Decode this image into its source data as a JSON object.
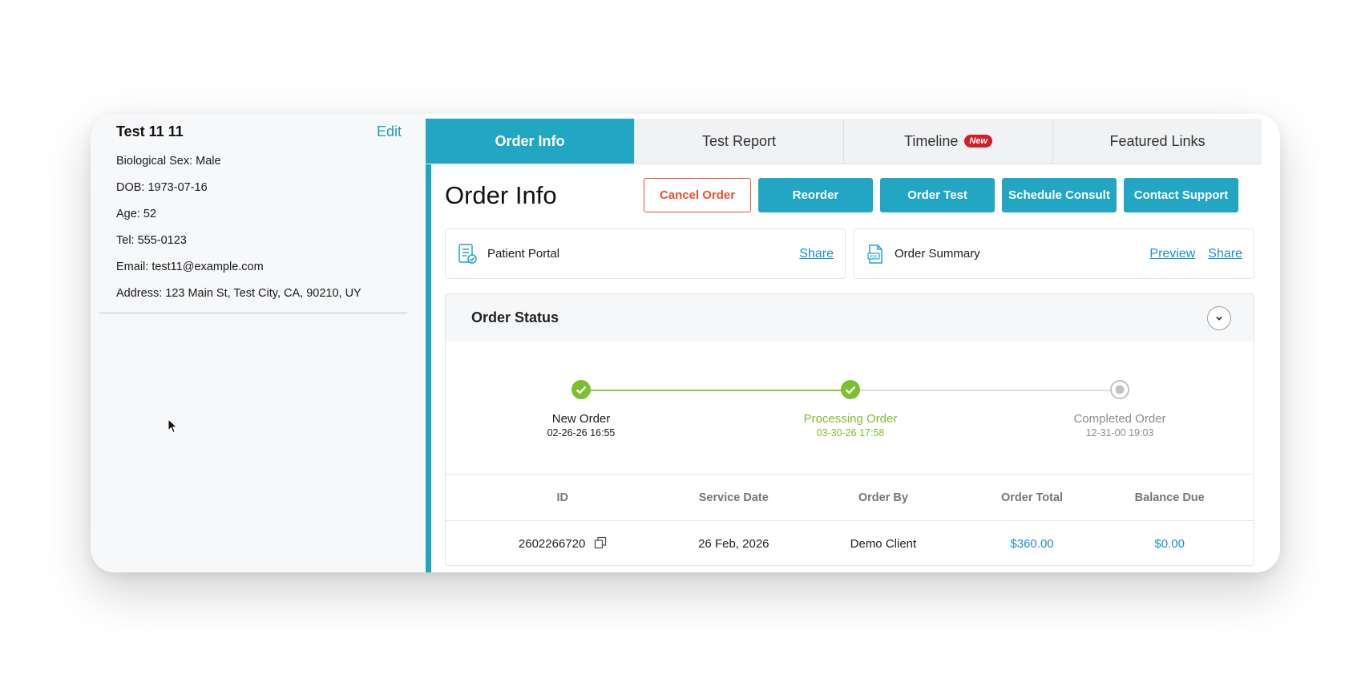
{
  "patient": {
    "name": "Test 11 11",
    "edit_label": "Edit",
    "info": [
      "Biological Sex: Male",
      "DOB: 1973-07-16",
      "Age: 52",
      "Tel: 555-0123",
      "Email: test11@example.com",
      "Address: 123 Main St, Test City, CA, 90210, UY"
    ]
  },
  "tabs": [
    {
      "label": "Order Info",
      "active": true
    },
    {
      "label": "Test Report",
      "active": false
    },
    {
      "label": "Timeline",
      "active": false,
      "badge": "New"
    },
    {
      "label": "Featured Links",
      "active": false
    }
  ],
  "page": {
    "title": "Order Info",
    "buttons": {
      "cancel": "Cancel Order",
      "reorder": "Reorder",
      "order_test": "Order Test",
      "schedule": "Schedule Consult",
      "support": "Contact Support"
    }
  },
  "links": {
    "portal": {
      "label": "Patient Portal",
      "share": "Share"
    },
    "summary": {
      "label": "Order Summary",
      "preview": "Preview",
      "share": "Share"
    }
  },
  "order_status": {
    "title": "Order Status",
    "steps": [
      {
        "name": "New Order",
        "date": "02-26-26 16:55",
        "state": "done"
      },
      {
        "name": "Processing Order",
        "date": "03-30-26 17:58",
        "state": "current"
      },
      {
        "name": "Completed Order",
        "date": "12-31-00 19:03",
        "state": "pending"
      }
    ]
  },
  "table": {
    "headers": [
      "ID",
      "Service Date",
      "Order By",
      "Order Total",
      "Balance Due"
    ],
    "row": {
      "id": "2602266720",
      "service_date": "26 Feb, 2026",
      "order_by": "Demo Client",
      "order_total": "$360.00",
      "balance_due": "$0.00"
    }
  },
  "colors": {
    "accent": "#22a6c4",
    "danger": "#e9532b",
    "success": "#7cbf2f",
    "link": "#1e8fc8"
  }
}
